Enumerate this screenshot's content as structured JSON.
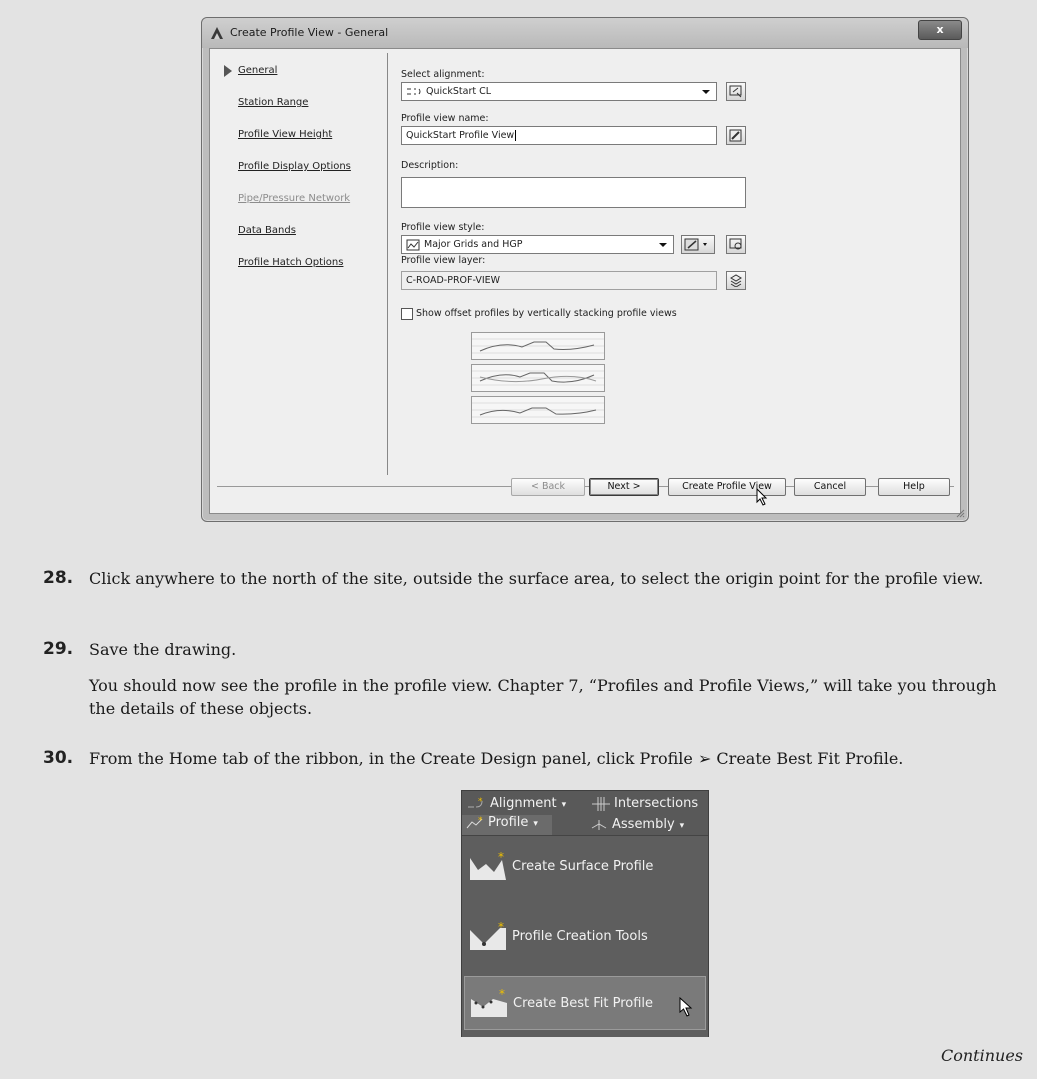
{
  "dialog": {
    "title": "Create Profile View - General",
    "close_label": "x",
    "nav": [
      {
        "label": "General",
        "active": true,
        "enabled": true
      },
      {
        "label": "Station Range",
        "active": false,
        "enabled": true
      },
      {
        "label": "Profile View Height",
        "active": false,
        "enabled": true
      },
      {
        "label": "Profile Display Options",
        "active": false,
        "enabled": true
      },
      {
        "label": "Pipe/Pressure Network",
        "active": false,
        "enabled": false
      },
      {
        "label": "Data Bands",
        "active": false,
        "enabled": true
      },
      {
        "label": "Profile Hatch Options",
        "active": false,
        "enabled": true
      }
    ],
    "form": {
      "alignment_label": "Select alignment:",
      "alignment_value": "QuickStart CL",
      "name_label": "Profile view name:",
      "name_value": "QuickStart Profile View",
      "description_label": "Description:",
      "description_value": "",
      "style_label": "Profile view style:",
      "style_value": "Major Grids and HGP",
      "layer_label": "Profile view layer:",
      "layer_value": "C-ROAD-PROF-VIEW",
      "offset_checkbox_label": "Show offset profiles by vertically stacking profile views",
      "offset_checked": false
    },
    "buttons": {
      "back": "< Back",
      "next": "Next >",
      "create": "Create Profile View",
      "cancel": "Cancel",
      "help": "Help"
    }
  },
  "steps": [
    {
      "num": "28.",
      "text": "Click anywhere to the north of the site, outside the surface area, to select the origin point for the profile view."
    },
    {
      "num": "29.",
      "text": "Save the drawing."
    },
    {
      "num": "",
      "text": "You should now see the profile in the profile view. Chapter 7, “Profiles and Profile Views,” will take you through the details of these objects."
    },
    {
      "num": "30.",
      "text": "From the Home tab of the ribbon, in the Create Design panel, click Profile ➢ Create Best Fit Profile."
    }
  ],
  "ribbon": {
    "alignment": "Alignment",
    "intersections": "Intersections",
    "profile": "Profile",
    "assembly": "Assembly",
    "menu_items": [
      {
        "label": "Create Surface Profile",
        "highlighted": false
      },
      {
        "label": "Profile Creation Tools",
        "highlighted": false
      },
      {
        "label": "Create Best Fit Profile",
        "highlighted": true
      }
    ]
  },
  "footer": {
    "continues": "Continues"
  }
}
